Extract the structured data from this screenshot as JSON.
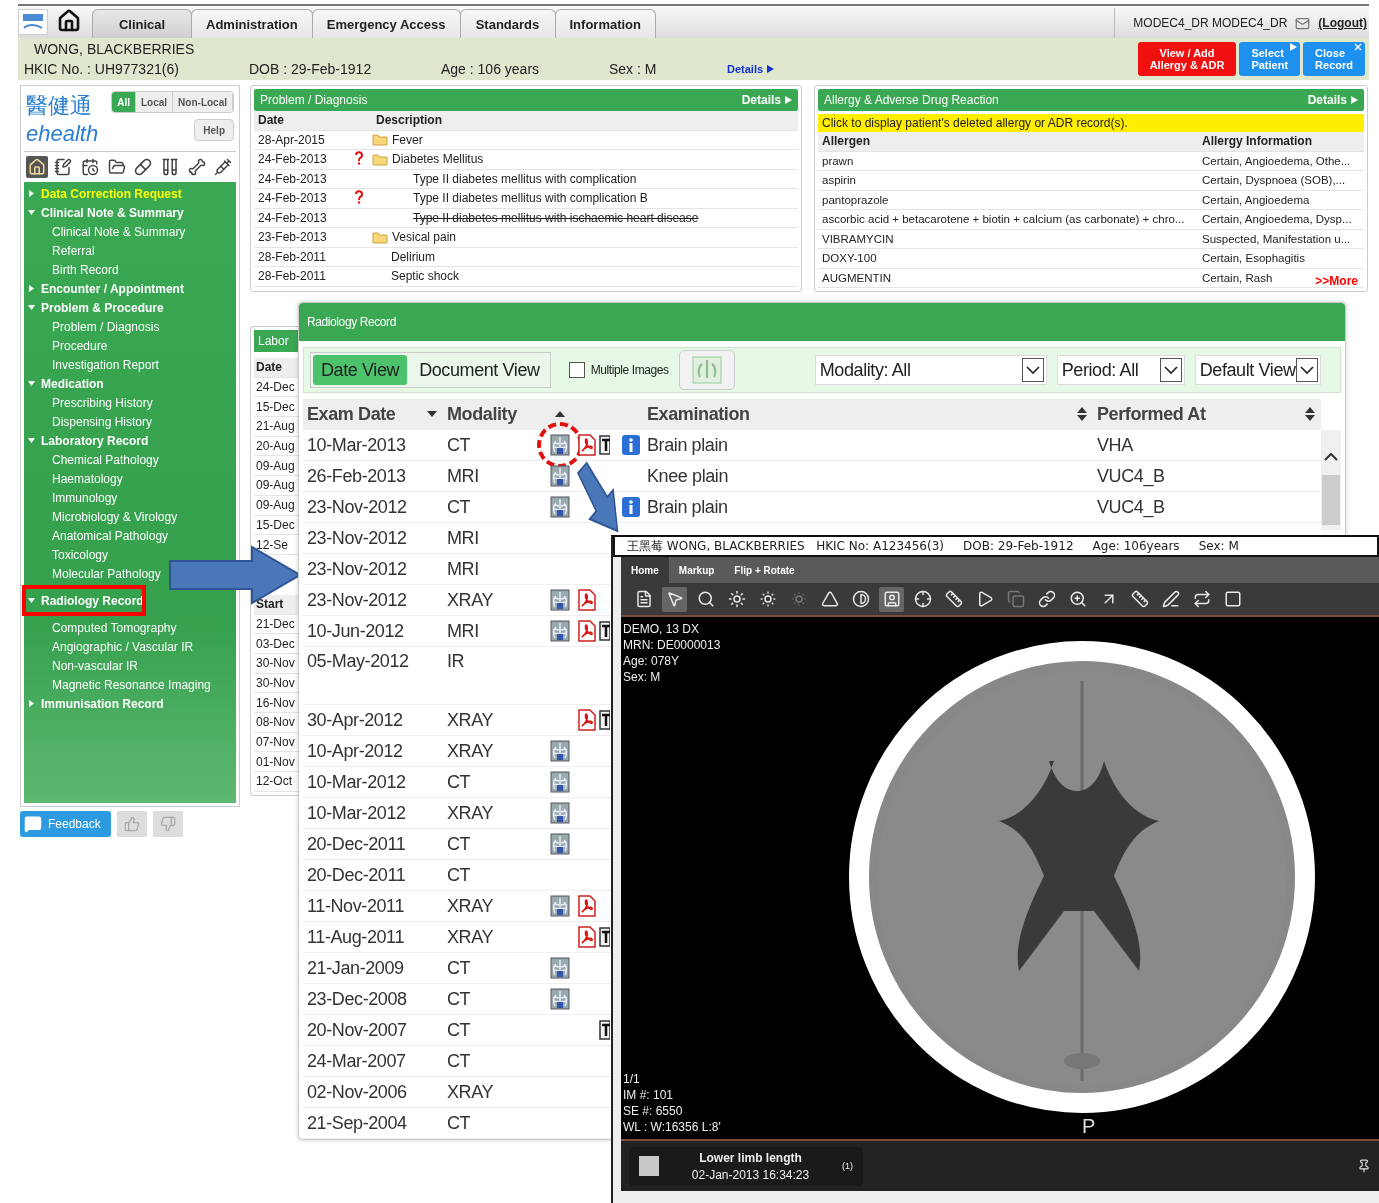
{
  "top_bar": {
    "tabs": [
      {
        "label": "Clinical",
        "selected": true
      },
      {
        "label": "Administration",
        "selected": false
      },
      {
        "label": "Emergency Access",
        "selected": false
      },
      {
        "label": "Standards",
        "selected": false
      },
      {
        "label": "Information",
        "selected": false
      }
    ],
    "user": "MODEC4_DR MODEC4_DR",
    "logout": "(Logout)"
  },
  "patient": {
    "name": "WONG, BLACKBERRIES",
    "hkic": "HKIC No. : UH977321(6)",
    "dob": "DOB : 29-Feb-1912",
    "age": "Age : 106 years",
    "sex": "Sex : M",
    "details": "Details",
    "buttons": [
      {
        "kind": "allergy",
        "lines": [
          "View / Add",
          "Allergy & ADR"
        ]
      },
      {
        "kind": "select",
        "lines": [
          "Select",
          "Patient"
        ]
      },
      {
        "kind": "close",
        "lines": [
          "Close",
          "Record"
        ]
      }
    ]
  },
  "sidebar": {
    "logo_chinese": "醫健通",
    "logo_latin": "ehealth",
    "filters": [
      {
        "label": "All",
        "selected": true
      },
      {
        "label": "Local",
        "selected": false
      },
      {
        "label": "Non-Local",
        "selected": false
      }
    ],
    "help": "Help",
    "items": [
      {
        "label": "Data Correction Request",
        "highlight": true,
        "expanded": false,
        "selected": false
      },
      {
        "label": "Clinical Note & Summary",
        "highlight": false,
        "expanded": true,
        "selected": false,
        "children": [
          {
            "label": "Clinical Note & Summary",
            "selected": false
          },
          {
            "label": "Referral",
            "selected": false
          },
          {
            "label": "Birth Record",
            "selected": false
          }
        ]
      },
      {
        "label": "Encounter / Appointment",
        "highlight": false,
        "expanded": false,
        "selected": false
      },
      {
        "label": "Problem & Procedure",
        "highlight": false,
        "expanded": true,
        "selected": false,
        "children": [
          {
            "label": "Problem / Diagnosis",
            "selected": false
          },
          {
            "label": "Procedure",
            "selected": false
          },
          {
            "label": "Investigation Report",
            "selected": false
          }
        ]
      },
      {
        "label": "Medication",
        "highlight": false,
        "expanded": true,
        "selected": false,
        "children": [
          {
            "label": "Prescribing History",
            "selected": false
          },
          {
            "label": "Dispensing History",
            "selected": false
          }
        ]
      },
      {
        "label": "Laboratory Record",
        "highlight": false,
        "expanded": true,
        "selected": false,
        "children": [
          {
            "label": "Chemical Pathology",
            "selected": false
          },
          {
            "label": "Haematology",
            "selected": false
          },
          {
            "label": "Immunology",
            "selected": false
          },
          {
            "label": "Microbiology & Virology",
            "selected": false
          },
          {
            "label": "Anatomical Pathology",
            "selected": false
          },
          {
            "label": "Toxicology",
            "selected": false
          },
          {
            "label": "Molecular Pathology",
            "selected": false
          }
        ]
      },
      {
        "label": "Radiology Record",
        "highlight": false,
        "expanded": true,
        "selected": true,
        "children": [
          {
            "label": "Computed Tomography",
            "selected": false
          },
          {
            "label": "Angiographic / Vascular IR",
            "selected": false
          },
          {
            "label": "Non-vascular IR",
            "selected": false
          },
          {
            "label": "Magnetic Resonance Imaging",
            "selected": false
          }
        ]
      },
      {
        "label": "Immunisation Record",
        "highlight": false,
        "expanded": false,
        "selected": false
      }
    ],
    "feedback": "Feedback"
  },
  "problem_panel": {
    "title": "Problem / Diagnosis",
    "details": "Details",
    "columns": [
      "Date",
      "Description"
    ],
    "rows": [
      {
        "date": "28-Apr-2015",
        "description": "Fever",
        "folder": true,
        "query": false,
        "deleted": false
      },
      {
        "date": "24-Feb-2013",
        "description": "Diabetes Mellitus",
        "folder": true,
        "query": true,
        "deleted": false,
        "children": [
          {
            "date": "24-Feb-2013",
            "description": "Type II diabetes mellitus with complication",
            "folder": false,
            "query": false,
            "deleted": false
          },
          {
            "date": "24-Feb-2013",
            "description": "Type II diabetes mellitus with complication B",
            "folder": false,
            "query": true,
            "deleted": false
          },
          {
            "date": "24-Feb-2013",
            "description": "Type II diabetes mellitus with ischaemic heart disease",
            "folder": false,
            "query": false,
            "deleted": true
          }
        ]
      },
      {
        "date": "23-Feb-2013",
        "description": "Vesical pain",
        "folder": true,
        "query": false,
        "deleted": false
      },
      {
        "date": "28-Feb-2011",
        "description": "Delirium",
        "folder": false,
        "query": false,
        "deleted": false
      },
      {
        "date": "28-Feb-2011",
        "description": "Septic shock",
        "folder": false,
        "query": false,
        "deleted": false
      }
    ]
  },
  "allergy_panel": {
    "title": "Allergy & Adverse Drug Reaction",
    "details": "Details",
    "notice": "Click to display patient's deleted allergy or ADR record(s).",
    "columns": [
      "Allergen",
      "Allergy Information"
    ],
    "rows": [
      {
        "allergen": "prawn",
        "information": "Certain, Angioedema, Othe..."
      },
      {
        "allergen": "aspirin",
        "information": "Certain, Dyspnoea (SOB),..."
      },
      {
        "allergen": "pantoprazole",
        "information": "Certain, Angioedema"
      },
      {
        "allergen": "ascorbic acid + betacarotene + biotin + calcium (as carbonate) + chro...",
        "information": "Certain, Angioedema, Dysp..."
      },
      {
        "allergen": "VIBRAMYCIN",
        "information": "Suspected, Manifestation u..."
      },
      {
        "allergen": "DOXY-100",
        "information": "Certain, Esophagitis"
      },
      {
        "allergen": "AUGMENTIN",
        "information": "Certain, Rash"
      }
    ],
    "more": ">>More"
  },
  "lab_panel": {
    "title": "Labor",
    "sections": [
      {
        "header": "Date",
        "dates": [
          "24-Dec",
          "15-Dec",
          "21-Aug",
          "20-Aug",
          "09-Aug",
          "09-Aug",
          "09-Aug",
          "15-Dec",
          "12-Se"
        ]
      },
      {
        "header": "Start",
        "dates": [
          "21-Dec",
          "03-Dec",
          "30-Nov",
          "30-Nov",
          "16-Nov",
          "08-Nov",
          "07-Nov",
          "01-Nov",
          "12-Oct"
        ]
      }
    ]
  },
  "radiology_window": {
    "title": "Radiology Record",
    "views": [
      {
        "label": "Date View",
        "selected": true
      },
      {
        "label": "Document View",
        "selected": false
      }
    ],
    "multiple_images": {
      "label": "Multiple Images",
      "checked": false
    },
    "selects": [
      {
        "value": "Modality: All",
        "kind": "wide"
      },
      {
        "value": "Period: All",
        "kind": "medium"
      },
      {
        "value": "Default View",
        "kind": "narrow"
      }
    ],
    "columns": {
      "date": "Exam Date",
      "modality": "Modality",
      "examination": "Examination",
      "performed_at": "Performed At"
    },
    "rows": [
      {
        "date": "10-Mar-2013",
        "modality": "CT",
        "image": true,
        "pdf": true,
        "text_report": true,
        "info": true,
        "circled": true,
        "tall": false,
        "examination": "Brain plain",
        "performed_at": "VHA"
      },
      {
        "date": "26-Feb-2013",
        "modality": "MRI",
        "image": true,
        "pdf": false,
        "text_report": false,
        "info": false,
        "circled": false,
        "tall": false,
        "examination": "Knee plain",
        "performed_at": "VUC4_B"
      },
      {
        "date": "23-Nov-2012",
        "modality": "CT",
        "image": true,
        "pdf": false,
        "text_report": false,
        "info": true,
        "circled": false,
        "tall": false,
        "examination": "Brain plain",
        "performed_at": "VUC4_B"
      },
      {
        "date": "23-Nov-2012",
        "modality": "MRI",
        "image": false,
        "pdf": false,
        "text_report": false,
        "circled": false,
        "tall": false
      },
      {
        "date": "23-Nov-2012",
        "modality": "MRI",
        "image": false,
        "pdf": false,
        "text_report": false,
        "circled": false,
        "tall": false
      },
      {
        "date": "23-Nov-2012",
        "modality": "XRAY",
        "image": true,
        "pdf": true,
        "text_report": false,
        "circled": false,
        "tall": false
      },
      {
        "date": "10-Jun-2012",
        "modality": "MRI",
        "image": true,
        "pdf": true,
        "text_report": true,
        "circled": false,
        "tall": false
      },
      {
        "date": "05-May-2012",
        "modality": "IR",
        "image": false,
        "pdf": false,
        "text_report": false,
        "circled": false,
        "tall": true
      },
      {
        "date": "30-Apr-2012",
        "modality": "XRAY",
        "image": false,
        "pdf": true,
        "text_report": true,
        "circled": false,
        "tall": false
      },
      {
        "date": "10-Apr-2012",
        "modality": "XRAY",
        "image": true,
        "pdf": false,
        "text_report": false,
        "circled": false,
        "tall": false
      },
      {
        "date": "10-Mar-2012",
        "modality": "CT",
        "image": true,
        "pdf": false,
        "text_report": false,
        "circled": false,
        "tall": false
      },
      {
        "date": "10-Mar-2012",
        "modality": "XRAY",
        "image": true,
        "pdf": false,
        "text_report": false,
        "circled": false,
        "tall": false
      },
      {
        "date": "20-Dec-2011",
        "modality": "CT",
        "image": true,
        "pdf": false,
        "text_report": false,
        "circled": false,
        "tall": false
      },
      {
        "date": "20-Dec-2011",
        "modality": "CT",
        "image": false,
        "pdf": false,
        "text_report": false,
        "circled": false,
        "tall": false
      },
      {
        "date": "11-Nov-2011",
        "modality": "XRAY",
        "image": true,
        "pdf": true,
        "text_report": false,
        "circled": false,
        "tall": false
      },
      {
        "date": "11-Aug-2011",
        "modality": "XRAY",
        "image": false,
        "pdf": true,
        "text_report": true,
        "circled": false,
        "tall": false
      },
      {
        "date": "21-Jan-2009",
        "modality": "CT",
        "image": true,
        "pdf": false,
        "text_report": false,
        "circled": false,
        "tall": false
      },
      {
        "date": "23-Dec-2008",
        "modality": "CT",
        "image": true,
        "pdf": false,
        "text_report": false,
        "circled": false,
        "tall": false
      },
      {
        "date": "20-Nov-2007",
        "modality": "CT",
        "image": false,
        "pdf": false,
        "text_report": true,
        "circled": false,
        "tall": false
      },
      {
        "date": "24-Mar-2007",
        "modality": "CT",
        "image": false,
        "pdf": false,
        "text_report": false,
        "circled": false,
        "tall": false
      },
      {
        "date": "02-Nov-2006",
        "modality": "XRAY",
        "image": false,
        "pdf": false,
        "text_report": false,
        "circled": false,
        "tall": false
      },
      {
        "date": "21-Sep-2004",
        "modality": "CT",
        "image": false,
        "pdf": false,
        "text_report": false,
        "circled": false,
        "tall": false
      }
    ]
  },
  "viewer": {
    "header": "王黑莓 WONG, BLACKBERRIES   HKIC No: A123456(3)     DOB: 29-Feb-1912     Age: 106years     Sex: M",
    "tabs": [
      {
        "label": "Home",
        "selected": true
      },
      {
        "label": "Markup",
        "selected": false
      },
      {
        "label": "Flip + Rotate",
        "selected": false
      }
    ],
    "overlay_top": [
      "DEMO, 13 DX",
      "MRN: DE0000013",
      "Age: 078Y",
      "Sex: M"
    ],
    "orientation_mark": "P",
    "overlay_bottom": [
      "1/1",
      "IM #: 101",
      "SE #: 6550",
      "WL : W:16356 L:8'"
    ],
    "thumbnail": {
      "title": "Lower limb length",
      "date": "02-Jan-2013 16:34:23",
      "count": "(1)"
    }
  }
}
